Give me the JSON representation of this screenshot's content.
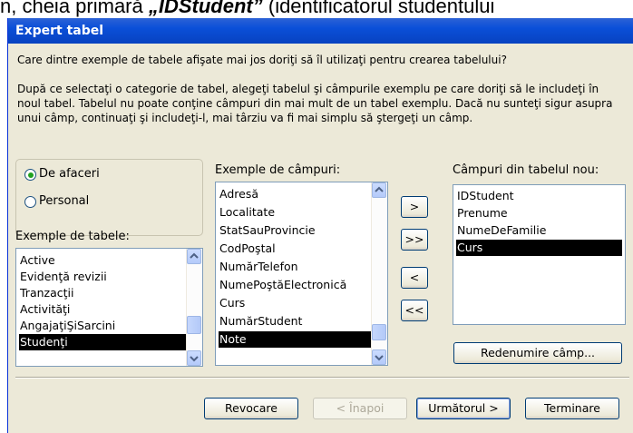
{
  "background_caption": {
    "before": "n, cheia primară ",
    "italic": "„IDStudent”",
    "after": " (identificatorul studentului"
  },
  "dialog": {
    "title": "Expert tabel",
    "question": "Care dintre exemple de tabele afişate mai jos doriţi să îl utilizaţi pentru crearea tabelului?",
    "instructions": "După ce selectaţi o categorie de tabel, alegeţi tabelul şi câmpurile exemplu pe care doriţi să le includeţi în noul tabel. Tabelul nu poate conţine câmpuri din mai mult de un tabel exemplu. Dacă nu sunteţi sigur asupra unui câmp, continuaţi şi includeţi-l, mai târziu va fi mai simplu să ştergeţi un câmp.",
    "category": {
      "options": [
        {
          "label": "De afaceri",
          "selected": true
        },
        {
          "label": "Personal",
          "selected": false
        }
      ]
    },
    "sample_tables": {
      "label": "Exemple de tabele:",
      "items": [
        "Active",
        "Evidenţă revizii",
        "Tranzacţii",
        "Activităţi",
        "AngajaţiŞiSarcini",
        "Studenţi"
      ],
      "selected": "Studenţi"
    },
    "sample_fields": {
      "label": "Exemple de câmpuri:",
      "items": [
        "Adresă",
        "Localitate",
        "StatSauProvincie",
        "CodPoştal",
        "NumărTelefon",
        "NumePoştăElectronică",
        "Curs",
        "NumărStudent",
        "Note"
      ],
      "selected": "Note"
    },
    "move_buttons": {
      "add_one": ">",
      "add_all": ">>",
      "remove_one": "<",
      "remove_all": "<<"
    },
    "new_fields": {
      "label": "Câmpuri din tabelul nou:",
      "items": [
        "IDStudent",
        "Prenume",
        "NumeDeFamilie",
        "Curs"
      ],
      "selected": "Curs"
    },
    "rename_button": "Redenumire câmp...",
    "footer": {
      "cancel": "Revocare",
      "back": "< Înapoi",
      "next": "Următorul >",
      "finish": "Terminare"
    }
  }
}
